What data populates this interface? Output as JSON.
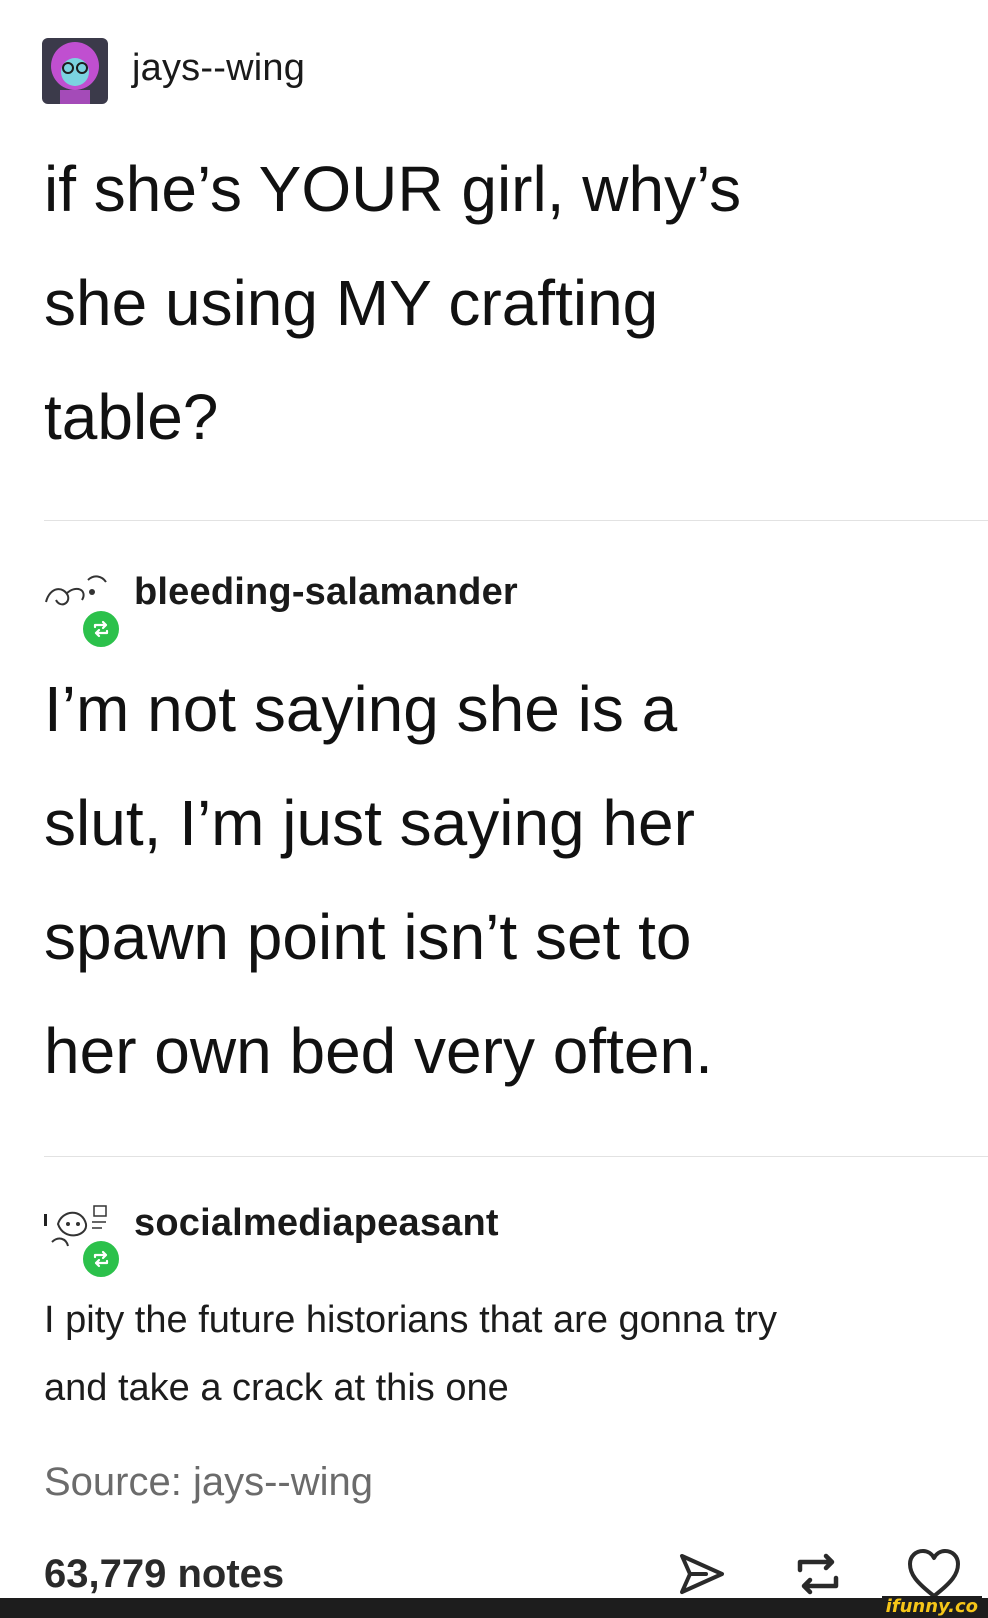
{
  "post1": {
    "username": "jays--wing",
    "text_lines": [
      "if she’s YOUR girl, why’s",
      "she using MY crafting",
      "table?"
    ]
  },
  "post2": {
    "username": "bleeding-salamander",
    "text_lines": [
      "I’m not saying she is a",
      "slut, I’m just saying her",
      "spawn point isn’t set to",
      "her own bed very often."
    ]
  },
  "post3": {
    "username": "socialmediapeasant",
    "text_lines": [
      "I pity the future historians that are gonna try",
      "and take a crack at this one"
    ]
  },
  "source_text": "Source: jays--wing",
  "notes_count": "63,779 notes",
  "watermark": "ifunny.co",
  "colors": {
    "reblog_green": "#2cc14b",
    "avatar_pink": "#c04fd0",
    "watermark_yellow": "#f5c518"
  },
  "icons": [
    "share-icon",
    "reblog-icon",
    "like-icon"
  ]
}
